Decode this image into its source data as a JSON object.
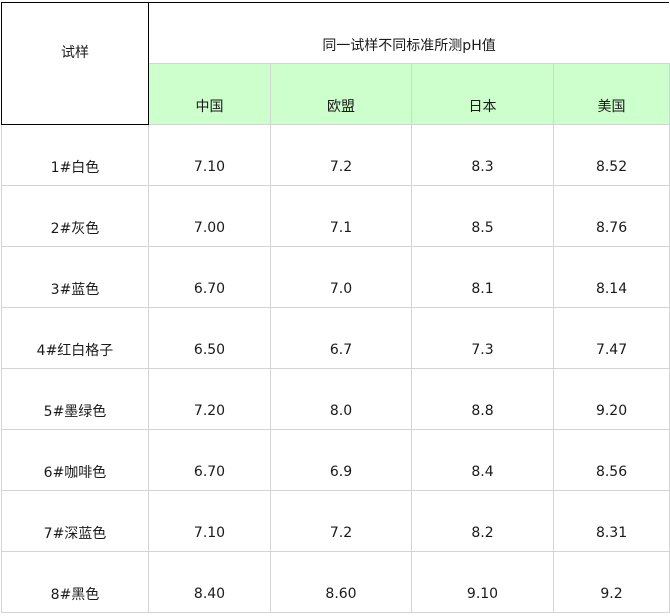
{
  "table": {
    "sample_header": "试样",
    "group_header": "同一试样不同标准所测pH值",
    "standards": [
      "中国",
      "欧盟",
      "日本",
      "美国"
    ],
    "rows": [
      {
        "sample": "1#白色",
        "values": [
          "7.10",
          "7.2",
          "8.3",
          "8.52"
        ]
      },
      {
        "sample": "2#灰色",
        "values": [
          "7.00",
          "7.1",
          "8.5",
          "8.76"
        ]
      },
      {
        "sample": "3#蓝色",
        "values": [
          "6.70",
          "7.0",
          "8.1",
          "8.14"
        ]
      },
      {
        "sample": "4#红白格子",
        "values": [
          "6.50",
          "6.7",
          "7.3",
          "7.47"
        ]
      },
      {
        "sample": "5#墨绿色",
        "values": [
          "7.20",
          "8.0",
          "8.8",
          "9.20"
        ]
      },
      {
        "sample": "6#咖啡色",
        "values": [
          "6.70",
          "6.9",
          "8.4",
          "8.56"
        ]
      },
      {
        "sample": "7#深蓝色",
        "values": [
          "7.10",
          "7.2",
          "8.2",
          "8.31"
        ]
      },
      {
        "sample": "8#黑色",
        "values": [
          "8.40",
          "8.60",
          "9.10",
          "9.2"
        ]
      }
    ]
  },
  "colors": {
    "header_fill": "#ccffcc",
    "grid_line": "#d4d4d4",
    "border": "#000000"
  }
}
